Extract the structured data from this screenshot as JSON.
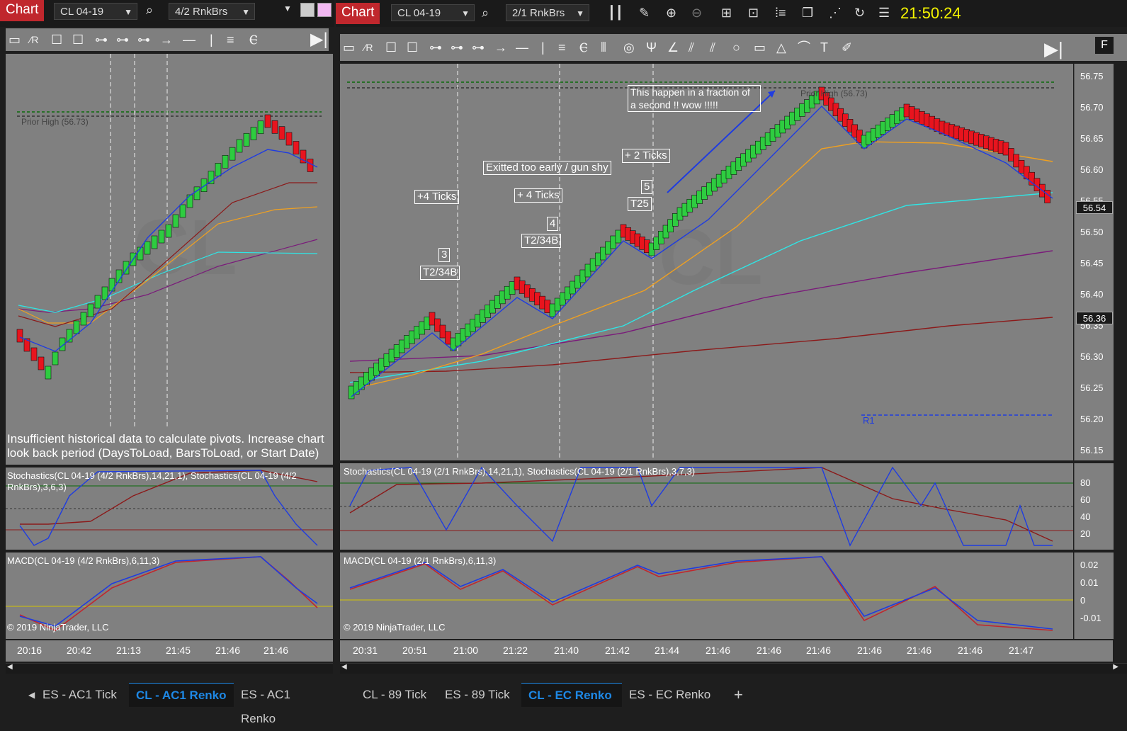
{
  "left": {
    "chart_button": "Chart",
    "instrument": "CL 04-19",
    "bar_type": "4/2 RnkBrs",
    "prior_high": "Prior High (56.73)",
    "watermark": "CL",
    "warning": "Insufficient historical data to calculate pivots. Increase chart look back period (DaysToLoad, BarsToLoad, or Start Date)",
    "stoch_label": "Stochastics(CL 04-19 (4/2 RnkBrs),14,21,1), Stochastics(CL 04-19 (4/2 RnkBrs),3,6,3)",
    "macd_label": "MACD(CL 04-19 (4/2 RnkBrs),6,11,3)",
    "copyright": "© 2019 NinjaTrader, LLC",
    "times": [
      "20:16",
      "20:42",
      "21:13",
      "21:45",
      "21:46",
      "21:46"
    ]
  },
  "right": {
    "chart_button": "Chart",
    "instrument": "CL 04-19",
    "bar_type": "2/1 RnkBrs",
    "clock": "21:50:24",
    "watermark": "CL",
    "prior_high": "Prior High (56.73)",
    "r1_label": "R1",
    "stoch_label": "Stochastics(CL 04-19 (2/1 RnkBrs),14,21,1), Stochastics(CL 04-19 (2/1 RnkBrs),3,7,3)",
    "macd_label": "MACD(CL 04-19 (2/1 RnkBrs),6,11,3)",
    "copyright": "© 2019 NinjaTrader, LLC",
    "price_ticks": [
      "56.75",
      "56.70",
      "56.65",
      "56.60",
      "56.55",
      "56.50",
      "56.45",
      "56.40",
      "56.35",
      "56.30",
      "56.25",
      "56.20",
      "56.15"
    ],
    "price_badge_1": "56.54",
    "price_badge_2": "56.36",
    "stoch_ticks": [
      "80",
      "60",
      "40",
      "20"
    ],
    "macd_ticks": [
      "0.02",
      "0.01",
      "0",
      "-0.01"
    ],
    "times": [
      "20:31",
      "20:51",
      "21:00",
      "21:22",
      "21:40",
      "21:42",
      "21:44",
      "21:46",
      "21:46",
      "21:46",
      "21:46",
      "21:46",
      "21:46",
      "21:47"
    ],
    "side_button": "F",
    "annotations": {
      "a1": "+4 Ticks",
      "a2": "3",
      "a3": "T2/34B",
      "a4": "Exitted too early / gun shy",
      "a5": "+ 4  Ticks",
      "a6": "4",
      "a7": "T2/34B",
      "a8": "+ 2 Ticks",
      "a9": "5",
      "a10": "T25",
      "a11": "This happen in a  fraction of a second  !!   wow  !!!!!"
    }
  },
  "tabs_left": [
    "ES - AC1 Tick",
    "CL - AC1 Renko",
    "ES - AC1 Renko"
  ],
  "tabs_right": [
    "CL - 89 Tick",
    "ES - 89 Tick",
    "CL - EC Renko",
    "ES - EC Renko"
  ],
  "add_tab": "+",
  "colors": {
    "up": "#2ecc40",
    "down": "#e8141e",
    "accent": "#1e88e5",
    "clock": "#f5f500",
    "chart_bg": "#808080"
  }
}
